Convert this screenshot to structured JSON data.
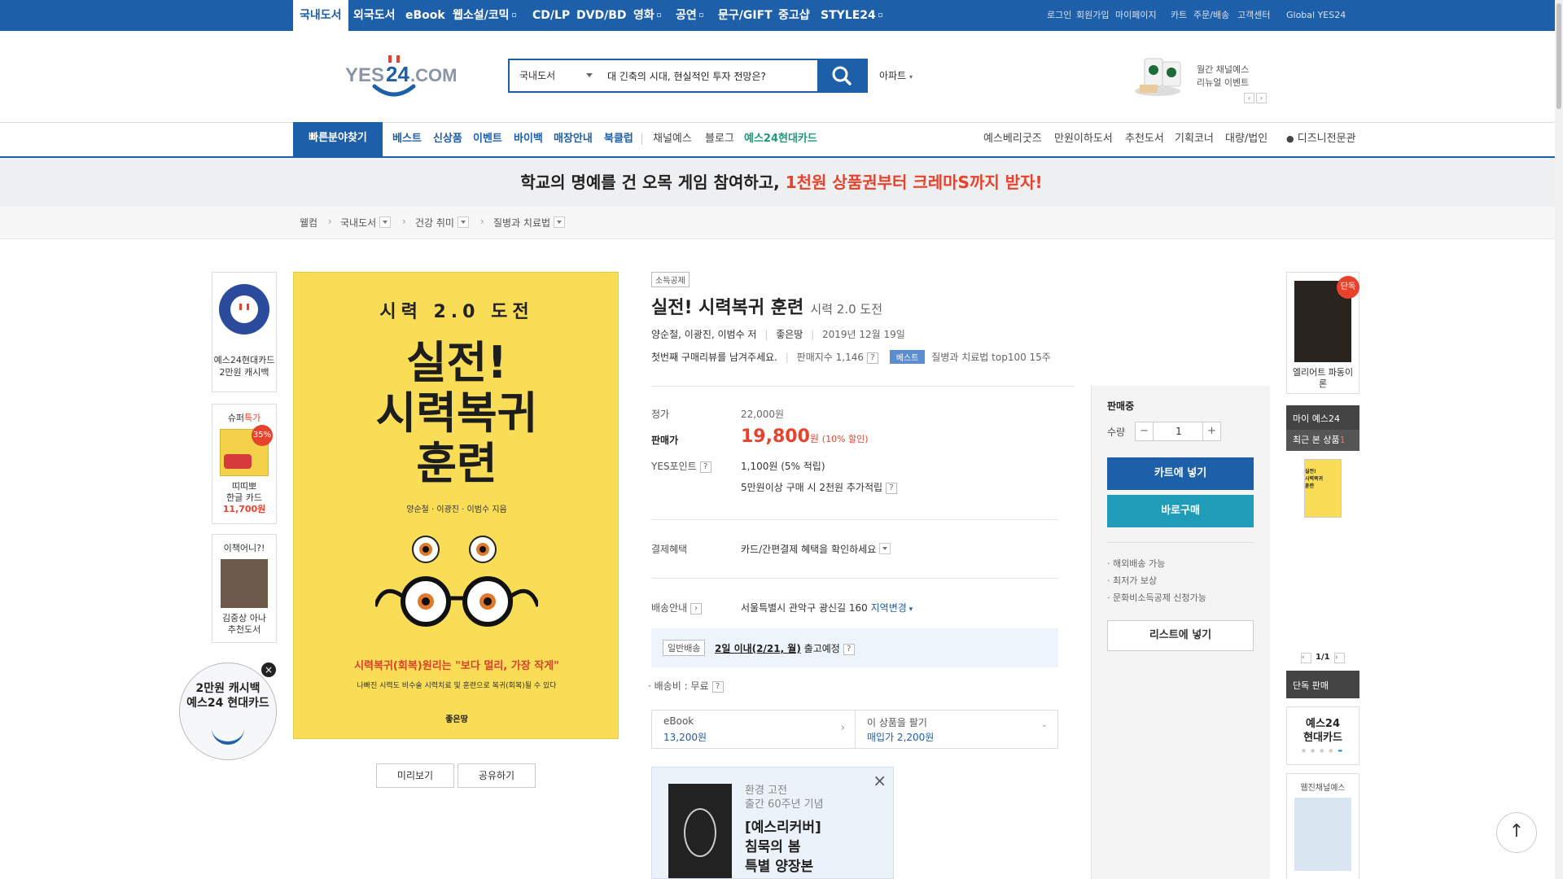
{
  "topbar": {
    "categories": [
      "국내도서",
      "외국도서",
      "eBook",
      "웹소설/코믹",
      "CD/LP",
      "DVD/BD",
      "영화",
      "공연",
      "문구/GIFT",
      "중고샵",
      "STYLE24"
    ],
    "utils": [
      "로그인",
      "회원가입",
      "마이페이지",
      "카트",
      "주문/배송",
      "고객센터",
      "Global YES24"
    ]
  },
  "header": {
    "logo_text": "YES24.COM",
    "search_scope": "국내도서",
    "search_value": "대 긴축의 시대, 현실적인 투자 전망은?",
    "apart_label": "아파트",
    "promo_line1": "월간 채널예스",
    "promo_line2": "리뉴얼 이벤트"
  },
  "nav": {
    "quick_find": "빠른분야찾기",
    "left_items": [
      "베스트",
      "신상품",
      "이벤트",
      "바이백",
      "매장안내",
      "북클럽"
    ],
    "mid_items": [
      "채널예스",
      "블로그",
      "예스24현대카드"
    ],
    "right_items": [
      "예스베리굿즈",
      "만원이하도서",
      "추천도서",
      "기획코너",
      "대량/법인",
      "디즈니전문관"
    ]
  },
  "banner": {
    "text_main": "학교의 명예를 건 오목 게임 참여하고,",
    "text_highlight": "1천원 상품권부터 크레마S까지 받자!"
  },
  "breadcrumb": [
    "웰컴",
    "국내도서",
    "건강 취미",
    "질병과 치료법"
  ],
  "left_sidebar": {
    "card_line1": "예스24현대카드",
    "card_line2": "2만원 캐시백",
    "super_label": "슈퍼",
    "super_highlight": "특가",
    "super_discount": "35%",
    "super_title1": "띠띠뽀",
    "super_title2": "한글 카드",
    "super_price": "11,700원",
    "book_q": "이책어니?!",
    "book_name1": "김중상 아나",
    "book_name2": "추천도서",
    "float_line1": "2만원 캐시백",
    "float_line2": "예스24 현대카드"
  },
  "cover": {
    "top": "시력 2.0 도전",
    "title1": "실전!",
    "title2": "시력복귀",
    "title3": "훈련",
    "authors": "양순철 · 이광진 · 이범수 지음",
    "tagline1": "시력복귀(회복)원리는 \"보다 멀리, 가장 작게\"",
    "tagline2": "나빠진 시력도 비수술 시력치료 및 훈련으로 복귀(회복)될 수 있다",
    "publisher": "좋은땅",
    "preview": "미리보기",
    "share": "공유하기"
  },
  "product": {
    "badge": "소득공제",
    "title": "실전! 시력복귀 훈련",
    "subtitle": "시력 2.0 도전",
    "authors": "양순철, 이광진, 이범수 저",
    "publisher": "좋은땅",
    "date": "2019년 12월 19일",
    "review_prompt": "첫번째 구매리뷰를 남겨주세요.",
    "sales_index": "판매지수 1,146",
    "best_badge": "베스트",
    "best_rank": "질병과 치료법 top100 15주",
    "price_label": "정가",
    "price_value": "22,000원",
    "sale_label": "판매가",
    "sale_value": "19,800",
    "sale_unit": "원",
    "sale_discount": "(10% 할인)",
    "point_label": "YES포인트",
    "point_value": "1,100원 (5% 적립)",
    "point_extra": "5만원이상 구매 시 2천원 추가적립",
    "pay_label": "결제혜택",
    "pay_value": "카드/간편결제 혜택을 확인하세요",
    "ship_label": "배송안내",
    "ship_address": "서울특별시 관악구 광신길 160",
    "ship_change": "지역변경",
    "ship_type": "일반배송",
    "ship_date": "2일 이내(2/21, 월)",
    "ship_suffix": "출고예정",
    "ship_fee": "· 배송비 : 무료",
    "ebook_label": "eBook",
    "ebook_price": "13,200원",
    "sell_label": "이 상품을 팔기",
    "sell_price": "매입가 2,200원"
  },
  "ad": {
    "line1": "환경 고전",
    "line2": "출간 60주년 기념",
    "line3": "[예스리커버]",
    "line4": "침묵의 봄",
    "line5": "특별 양장본"
  },
  "purchase": {
    "status": "판매중",
    "qty_label": "수량",
    "qty_value": "1",
    "cart": "카트에 넣기",
    "buy": "바로구매",
    "benefits": [
      "· 해외배송 가능",
      "· 최저가 보상",
      "· 문화비소득공제 신청가능"
    ],
    "list": "리스트에 넣기"
  },
  "right_sidebar": {
    "exclusive_badge": "단독",
    "exclusive_title": "엘리어트 파동이론",
    "my_label": "마이 예스24",
    "recent_label": "최근 본 상품",
    "recent_count": "1",
    "pager": "1/1",
    "exclusive_sale": "단독 판매",
    "card_line1": "예스24",
    "card_line2": "현대카드",
    "channel": "웹진채널예스"
  },
  "colors": {
    "brand": "#1d5fa8",
    "accent": "#e8412c",
    "buy": "#1f9cb8"
  }
}
